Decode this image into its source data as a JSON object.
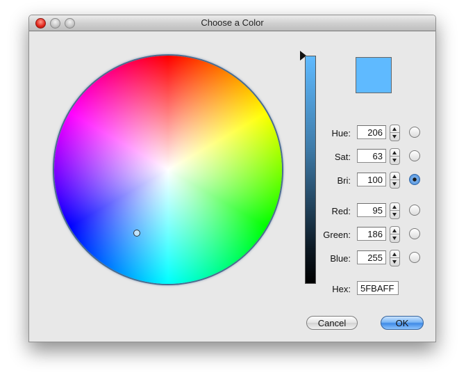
{
  "window": {
    "title": "Choose a Color"
  },
  "preview": {
    "color": "#5FBAFF"
  },
  "hsb": [
    {
      "label": "Hue:",
      "value": "206",
      "selected": false
    },
    {
      "label": "Sat:",
      "value": "63",
      "selected": false
    },
    {
      "label": "Bri:",
      "value": "100",
      "selected": true
    }
  ],
  "rgb": [
    {
      "label": "Red:",
      "value": "95",
      "selected": false
    },
    {
      "label": "Green:",
      "value": "186",
      "selected": false
    },
    {
      "label": "Blue:",
      "value": "255",
      "selected": false
    }
  ],
  "hex": {
    "label": "Hex:",
    "value": "5FBAFF"
  },
  "buttons": {
    "cancel": "Cancel",
    "ok": "OK"
  },
  "colors": {
    "accent": "#3f8ae6",
    "brightness_top": "#5fbaff"
  }
}
